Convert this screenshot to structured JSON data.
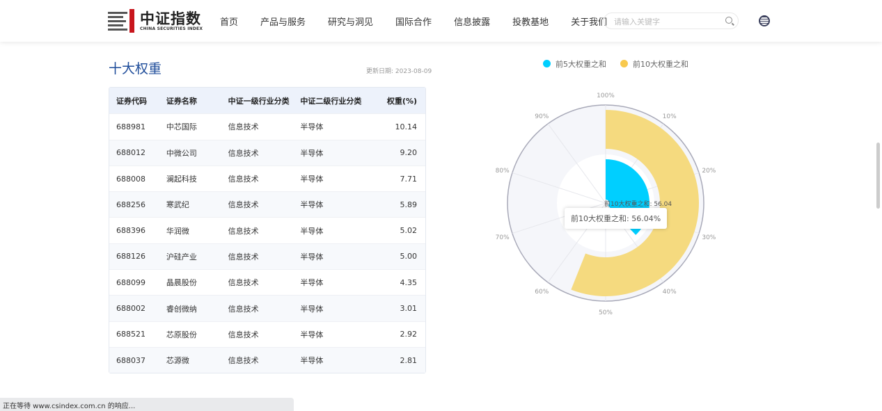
{
  "header": {
    "logo_cn": "中证指数",
    "logo_en": "CHINA SECURITIES INDEX",
    "nav": [
      "首页",
      "产品与服务",
      "研究与洞见",
      "国际合作",
      "信息披露",
      "投教基地",
      "关于我们"
    ],
    "search_placeholder": "请输入关键字"
  },
  "section": {
    "title": "十大权重",
    "updated": "更新日期: 2023-08-09"
  },
  "table": {
    "headers": [
      "证券代码",
      "证券名称",
      "中证一级行业分类",
      "中证二级行业分类",
      "权重(%)"
    ],
    "rows": [
      [
        "688981",
        "中芯国际",
        "信息技术",
        "半导体",
        "10.14"
      ],
      [
        "688012",
        "中微公司",
        "信息技术",
        "半导体",
        "9.20"
      ],
      [
        "688008",
        "澜起科技",
        "信息技术",
        "半导体",
        "7.71"
      ],
      [
        "688256",
        "寒武纪",
        "信息技术",
        "半导体",
        "5.89"
      ],
      [
        "688396",
        "华润微",
        "信息技术",
        "半导体",
        "5.02"
      ],
      [
        "688126",
        "沪硅产业",
        "信息技术",
        "半导体",
        "5.00"
      ],
      [
        "688099",
        "晶晨股份",
        "信息技术",
        "半导体",
        "4.35"
      ],
      [
        "688002",
        "睿创微纳",
        "信息技术",
        "半导体",
        "3.01"
      ],
      [
        "688521",
        "芯原股份",
        "信息技术",
        "半导体",
        "2.92"
      ],
      [
        "688037",
        "芯源微",
        "信息技术",
        "半导体",
        "2.81"
      ]
    ]
  },
  "chart_data": {
    "type": "polar-bar",
    "angle_range": [
      0,
      100
    ],
    "tick_labels": [
      "100%",
      "10%",
      "20%",
      "30%",
      "40%",
      "50%",
      "60%",
      "70%",
      "80%",
      "90%"
    ],
    "series": [
      {
        "name": "前5大权重之和",
        "value": 37.96,
        "color": "#00cfff"
      },
      {
        "name": "前10大权重之和",
        "value": 56.04,
        "color": "#f5da7f"
      }
    ],
    "label": "前10大权重之和: 56.04",
    "tooltip": "前10大权重之和: 56.04%",
    "legend": "top"
  },
  "status": "正在等待 www.csindex.com.cn 的响应..."
}
